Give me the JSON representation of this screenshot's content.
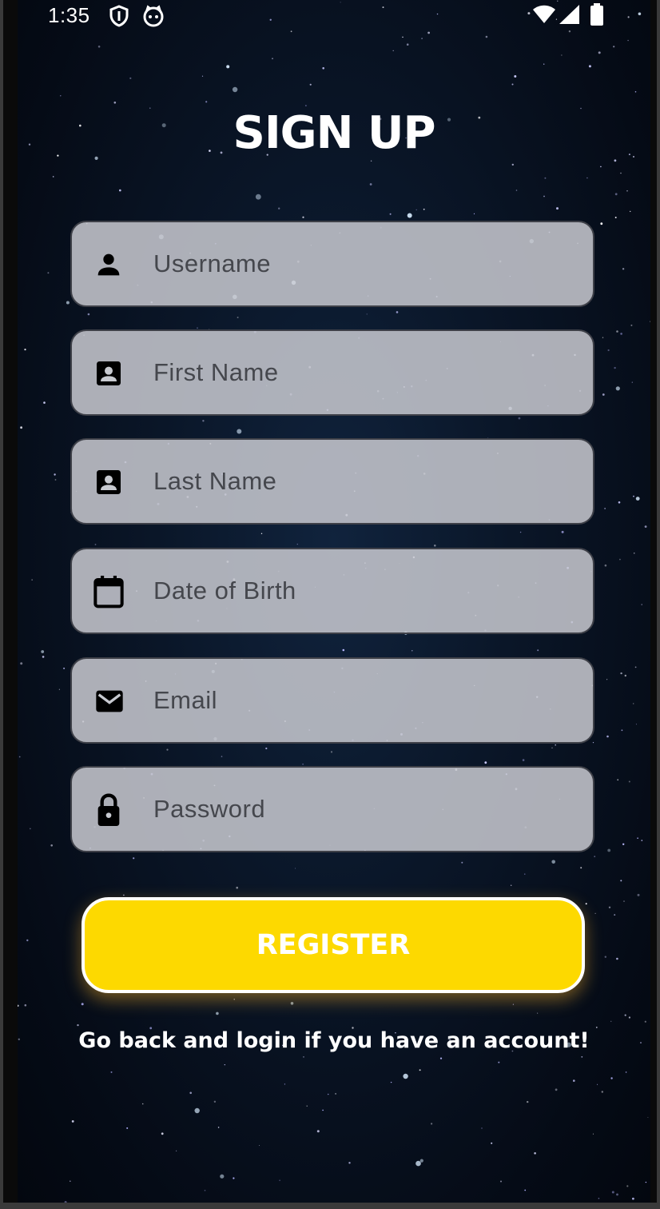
{
  "status_bar": {
    "time": "1:35",
    "icons": [
      "shield-icon",
      "cat-face-icon",
      "wifi-icon",
      "cellular-signal-icon",
      "battery-icon"
    ]
  },
  "screen": {
    "title": "SIGN UP",
    "fields": {
      "username": {
        "placeholder": "Username",
        "icon": "person-icon"
      },
      "first_name": {
        "placeholder": "First Name",
        "icon": "contact-card-icon"
      },
      "last_name": {
        "placeholder": "Last Name",
        "icon": "contact-card-icon"
      },
      "date_of_birth": {
        "placeholder": "Date of Birth",
        "icon": "calendar-icon"
      },
      "email": {
        "placeholder": "Email",
        "icon": "mail-icon"
      },
      "password": {
        "placeholder": "Password",
        "icon": "lock-icon"
      }
    },
    "register_label": "REGISTER",
    "login_link": "Go back and login if you have an account!"
  },
  "colors": {
    "background": "#0a1628",
    "field_background": "#c8cad0",
    "button": "#fdd900",
    "text": "#ffffff"
  }
}
